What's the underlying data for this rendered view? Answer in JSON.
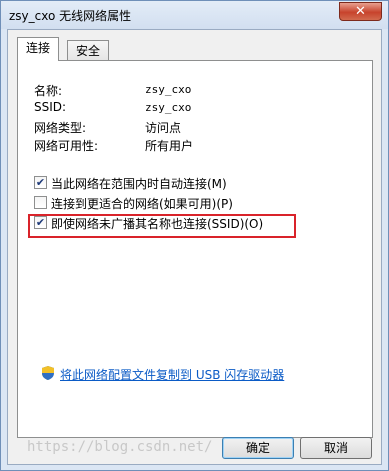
{
  "window": {
    "title": "zsy_cxo 无线网络属性",
    "close_label": "✕"
  },
  "tabs": [
    {
      "label": "连接"
    },
    {
      "label": "安全"
    }
  ],
  "fields": [
    {
      "label": "名称:",
      "value": "zsy_cxo"
    },
    {
      "label": "SSID:",
      "value": "zsy_cxo"
    },
    {
      "label": "网络类型:",
      "value": "访问点"
    },
    {
      "label": "网络可用性:",
      "value": "所有用户"
    }
  ],
  "options": [
    {
      "label": "当此网络在范围内时自动连接(M)",
      "checked": "✔"
    },
    {
      "label": "连接到更适合的网络(如果可用)(P)",
      "checked": ""
    },
    {
      "label": "即使网络未广播其名称也连接(SSID)(O)",
      "checked": "✔"
    }
  ],
  "link": {
    "text": "将此网络配置文件复制到 USB 闪存驱动器"
  },
  "buttons": {
    "ok": "确定",
    "cancel": "取消"
  },
  "watermark": "https://blog.csdn.net/"
}
